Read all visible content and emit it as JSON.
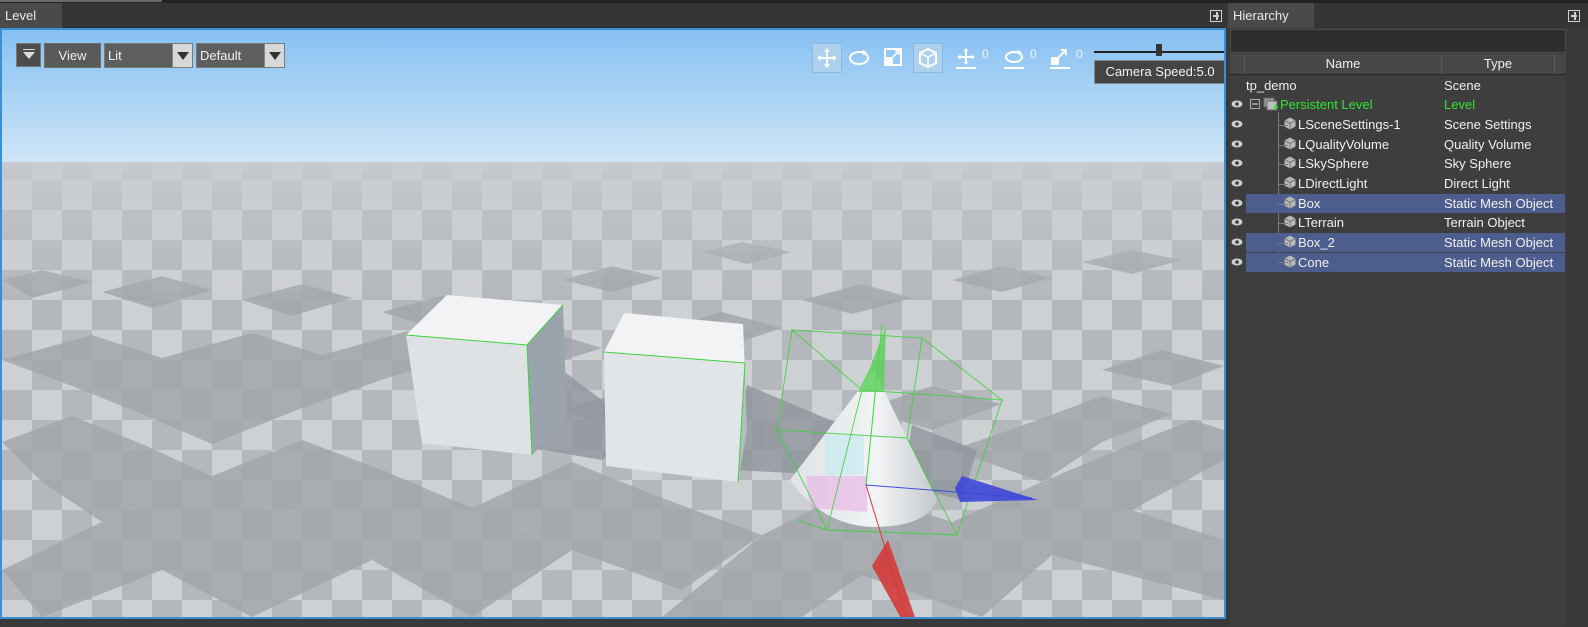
{
  "level_panel": {
    "tab_label": "Level",
    "view_button": "View",
    "shading_select": "Lit",
    "preset_select": "Default",
    "snap_translate_value": "0",
    "snap_rotate_value": "0",
    "snap_scale_value": "0",
    "camera_speed_label": "Camera Speed:5.0"
  },
  "hierarchy_panel": {
    "tab_label": "Hierarchy",
    "columns": {
      "name": "Name",
      "type": "Type"
    },
    "rows": [
      {
        "name": "tp_demo",
        "type": "Scene"
      },
      {
        "name": "Persistent Level",
        "type": "Level"
      },
      {
        "name": "LSceneSettings-1",
        "type": "Scene Settings"
      },
      {
        "name": "LQualityVolume",
        "type": "Quality Volume"
      },
      {
        "name": "LSkySphere",
        "type": "Sky Sphere"
      },
      {
        "name": "LDirectLight",
        "type": "Direct Light"
      },
      {
        "name": "Box",
        "type": "Static Mesh Object"
      },
      {
        "name": "LTerrain",
        "type": "Terrain Object"
      },
      {
        "name": "Box_2",
        "type": "Static Mesh Object"
      },
      {
        "name": "Cone",
        "type": "Static Mesh Object"
      }
    ]
  },
  "colors": {
    "selection_highlight": "#4d5e8e",
    "level_green": "#32e432",
    "viewport_border": "#3b8fd3"
  }
}
